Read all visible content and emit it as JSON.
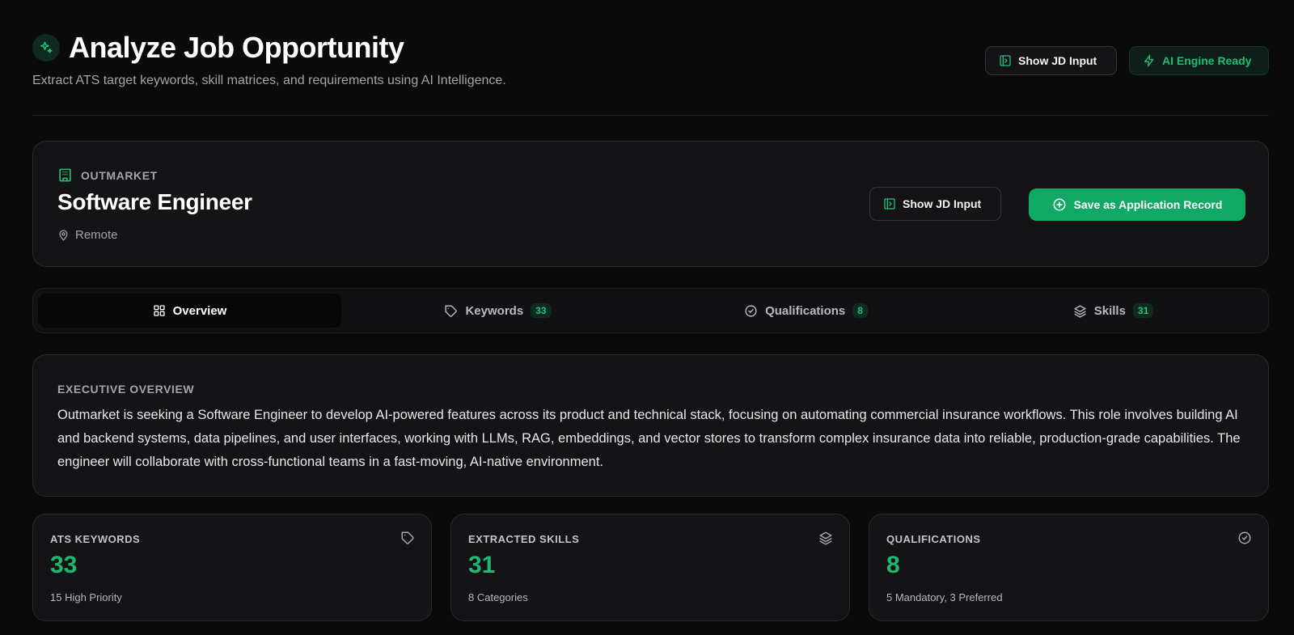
{
  "header": {
    "title": "Analyze Job Opportunity",
    "subtitle": "Extract ATS target keywords, skill matrices, and requirements using AI Intelligence.",
    "show_jd_label": "Show JD Input",
    "engine_status": "AI Engine Ready"
  },
  "job": {
    "company": "OUTMARKET",
    "title": "Software Engineer",
    "location": "Remote",
    "show_jd_label": "Show JD Input",
    "save_label": "Save as Application Record"
  },
  "tabs": [
    {
      "label": "Overview",
      "icon": "grid-icon",
      "active": true
    },
    {
      "label": "Keywords",
      "icon": "tag-icon",
      "count": "33"
    },
    {
      "label": "Qualifications",
      "icon": "check-circle-icon",
      "count": "8"
    },
    {
      "label": "Skills",
      "icon": "layers-icon",
      "count": "31"
    }
  ],
  "overview": {
    "heading": "EXECUTIVE OVERVIEW",
    "text": "Outmarket is seeking a Software Engineer to develop AI-powered features across its product and technical stack, focusing on automating commercial insurance workflows. This role involves building AI and backend systems, data pipelines, and user interfaces, working with LLMs, RAG, embeddings, and vector stores to transform complex insurance data into reliable, production-grade capabilities. The engineer will collaborate with cross-functional teams in a fast-moving, AI-native environment."
  },
  "stats": [
    {
      "label": "ATS KEYWORDS",
      "value": "33",
      "sub": "15 High Priority",
      "icon": "tag-icon"
    },
    {
      "label": "EXTRACTED SKILLS",
      "value": "31",
      "sub": "8 Categories",
      "icon": "layers-icon"
    },
    {
      "label": "QUALIFICATIONS",
      "value": "8",
      "sub": "5 Mandatory, 3 Preferred",
      "icon": "check-circle-icon"
    }
  ],
  "colors": {
    "accent": "#10a964",
    "accent_text": "#1fb873",
    "background": "#0a0a0b",
    "card": "#141416"
  }
}
